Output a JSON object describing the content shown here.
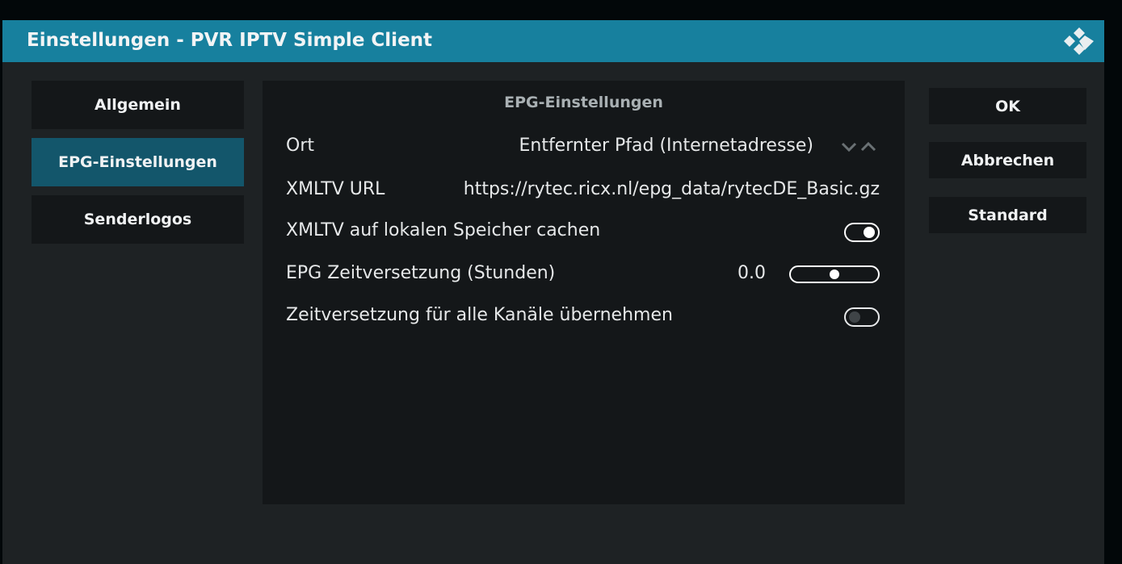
{
  "window": {
    "title": "Einstellungen - PVR IPTV Simple Client",
    "logo_icon": "kodi-logo-icon"
  },
  "sidebar": {
    "items": [
      {
        "label": "Allgemein",
        "active": false
      },
      {
        "label": "EPG-Einstellungen",
        "active": true
      },
      {
        "label": "Senderlogos",
        "active": false
      }
    ]
  },
  "panel": {
    "title": "EPG-Einstellungen",
    "settings": [
      {
        "label": "Ort",
        "value": "Entfernter Pfad (Internetadresse)",
        "control": "spinner"
      },
      {
        "label": "XMLTV URL",
        "value": "https://rytec.ricx.nl/epg_data/rytecDE_Basic.gz",
        "control": "text"
      },
      {
        "label": "XMLTV auf lokalen Speicher cachen",
        "control": "toggle",
        "checked": true
      },
      {
        "label": "EPG Zeitversetzung (Stunden)",
        "value": "0.0",
        "control": "slider",
        "slider_fraction": 0.5
      },
      {
        "label": "Zeitversetzung für alle Kanäle übernehmen",
        "control": "toggle",
        "checked": false
      }
    ]
  },
  "buttons": {
    "ok": "OK",
    "cancel": "Abbrechen",
    "default": "Standard"
  },
  "colors": {
    "titlebar": "#17809e",
    "active_item": "#13566b",
    "panel": "#141719",
    "dialog": "#1e2224"
  }
}
